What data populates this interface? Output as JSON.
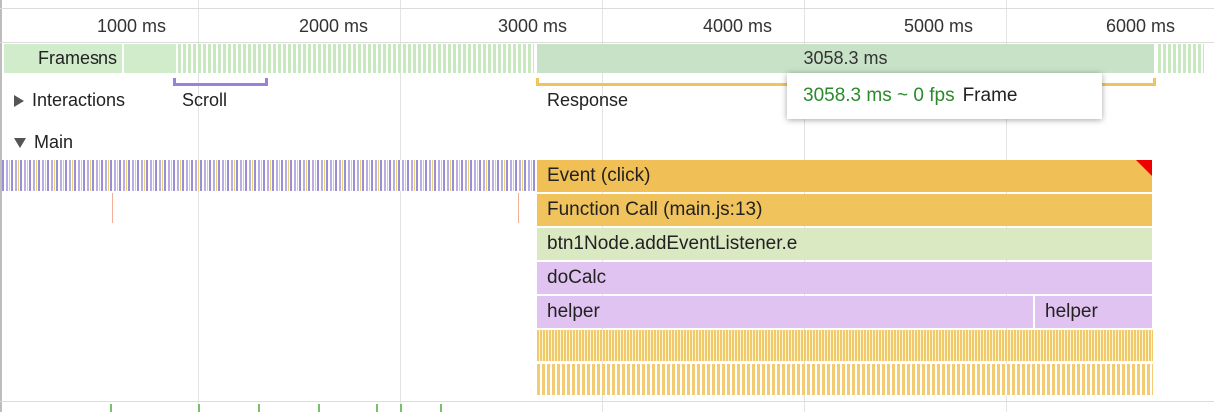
{
  "ruler": {
    "ticks": [
      "1000 ms",
      "2000 ms",
      "3000 ms",
      "4000 ms",
      "5000 ms",
      "6000 ms"
    ]
  },
  "frames": {
    "label": "Frames",
    "left_fragment": "ns",
    "long_frame_value": "3058.3 ms"
  },
  "interactions": {
    "label": "Interactions",
    "items": [
      "Scroll",
      "Response"
    ],
    "colors": {
      "scroll": "#9b7fdc",
      "response": "#f0c45a"
    }
  },
  "tooltip": {
    "fps_text": "3058.3 ms ~ 0 fps",
    "kind": "Frame"
  },
  "main": {
    "label": "Main",
    "slices": {
      "event": "Event (click)",
      "function_call": "Function Call (main.js:13)",
      "listener": "btn1Node.addEventListener.e",
      "docalc": "doCalc",
      "helper": "helper",
      "helper2": "helper"
    },
    "colors": {
      "event": "#f0bf55",
      "listener": "#dbe9c3",
      "script_purple": "#e0c3f0",
      "warning": "#e00000"
    }
  },
  "icons": [
    "expand-right-icon",
    "collapse-down-icon"
  ]
}
